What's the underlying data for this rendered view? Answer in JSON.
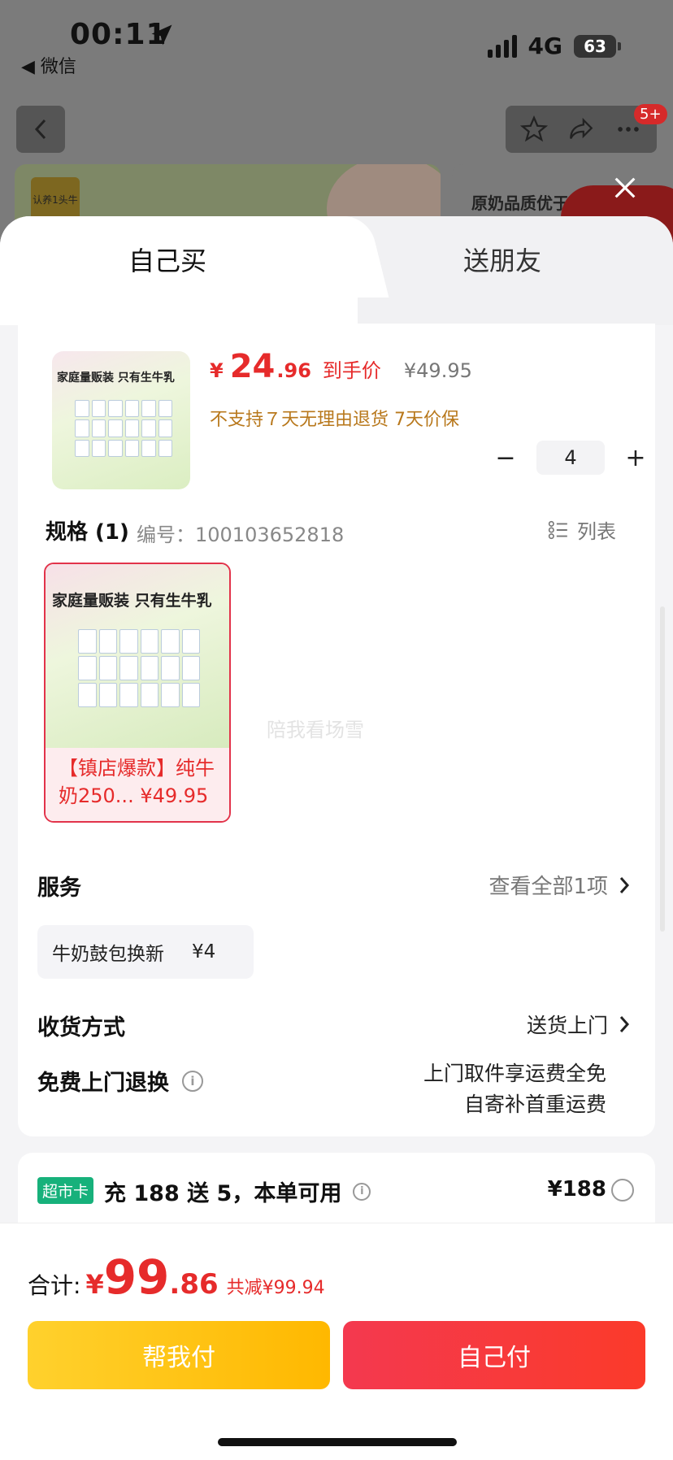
{
  "status_bar": {
    "time": "00:11",
    "back_app": "◀ 微信",
    "network": "4G",
    "battery": "63"
  },
  "background": {
    "logo_text": "认养1头牛",
    "card2_text": "原奶品质优于",
    "badge": "5+"
  },
  "tabs": [
    {
      "label": "自己买"
    },
    {
      "label": "送朋友"
    }
  ],
  "product": {
    "thumb_title": "家庭量贩装  只有生牛乳",
    "price_yen": "¥",
    "price_int": "24",
    "price_dec": ".96",
    "price_tag": "到手价",
    "original_price": "¥49.95",
    "notice": "不支持７天无理由退货   7天价保",
    "quantity": "4",
    "minus": "−",
    "plus": "+"
  },
  "spec": {
    "heading": "规格 (1)",
    "code": "编号：100103652818",
    "list_label": "列表",
    "item_title": "家庭量贩装  只有生牛乳",
    "item_caption": "【镇店爆款】纯牛奶250... ¥49.95",
    "watermark": "陪我看场雪"
  },
  "services": {
    "title": "服务",
    "more": "查看全部1项",
    "chip_name": "牛奶鼓包换新",
    "chip_price": "¥4"
  },
  "shipping": {
    "title": "收货方式",
    "value": "送货上门"
  },
  "returns": {
    "title": "免费上门退换",
    "line1": "上门取件享运费全免",
    "line2": "自寄补首重运费"
  },
  "promo": {
    "tag": "超市卡",
    "text": "充 188 送 5，本单可用",
    "price": "¥188"
  },
  "footer": {
    "total_label": "合计:",
    "total_yen": "¥",
    "total_int": "99",
    "total_dec": ".86",
    "total_save": "共减¥99.94",
    "help_pay": "帮我付",
    "self_pay": "自己付"
  },
  "colors": {
    "accent_red": "#e62b2b",
    "pay_yellow": "#ffc21a",
    "pay_red": "#f53a3a",
    "promo_green": "#17b17b"
  },
  "icons": [
    "location-arrow-icon",
    "back-arrow-icon",
    "star-icon",
    "share-icon",
    "more-icon",
    "close-icon",
    "list-icon",
    "chevron-right-icon",
    "info-icon"
  ]
}
